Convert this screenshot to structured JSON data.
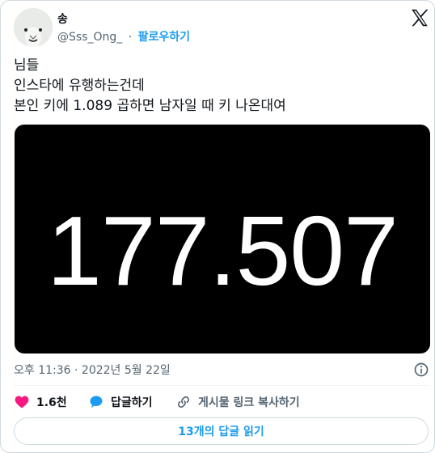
{
  "author": {
    "name": "송",
    "handle": "@Sss_Ong_",
    "separator": "·",
    "follow_label": "팔로우하기"
  },
  "tweet": {
    "lines": [
      "님들",
      "인스타에 유행하는건데",
      "본인 키에 1.089 곱하면 남자일 때 키 나온대여"
    ],
    "media_text": "177.507",
    "timestamp": "오후 11:36 · 2022년 5월 22일"
  },
  "actions": {
    "like_count": "1.6천",
    "reply_label": "답글하기",
    "copy_link_label": "게시물 링크 복사하기"
  },
  "replies_button": "13개의 답글 읽기",
  "icons": {
    "brand": "x-logo-icon",
    "like": "heart-icon",
    "reply": "speech-bubble-icon",
    "link": "link-icon",
    "info": "info-icon"
  },
  "colors": {
    "like": "#f91880",
    "accent": "#1d9bf0",
    "secondary_text": "#536471"
  }
}
